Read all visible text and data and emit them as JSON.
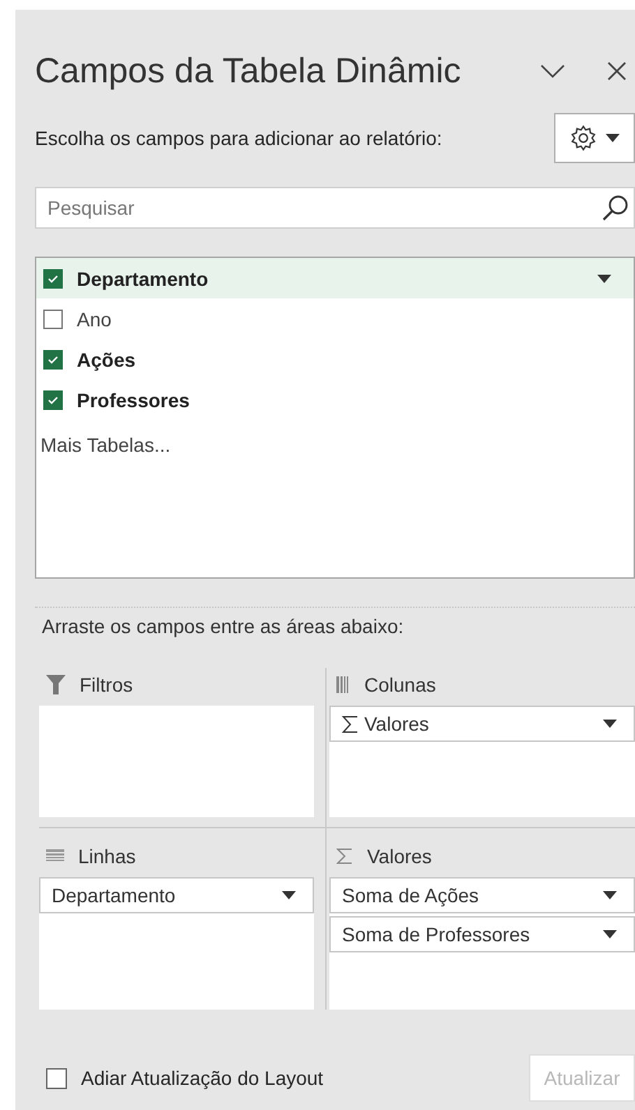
{
  "header": {
    "title": "Campos da Tabela Dinâmic",
    "subtitle": "Escolha os campos para adicionar ao relatório:"
  },
  "search": {
    "placeholder": "Pesquisar"
  },
  "fields": [
    {
      "label": "Departamento",
      "checked": true,
      "selected": true
    },
    {
      "label": "Ano",
      "checked": false,
      "selected": false
    },
    {
      "label": "Ações",
      "checked": true,
      "selected": false
    },
    {
      "label": "Professores",
      "checked": true,
      "selected": false
    }
  ],
  "more_tables": "Mais Tabelas...",
  "drag_hint": "Arraste os campos entre as áreas abaixo:",
  "areas": [
    {
      "kind": "filter",
      "title": "Filtros"
    },
    {
      "kind": "columns",
      "title": "Colunas",
      "items": [
        {
          "label": "Valores",
          "sigma": true
        }
      ]
    },
    {
      "kind": "rows",
      "title": "Linhas",
      "items": [
        {
          "label": "Departamento",
          "sigma": false
        }
      ]
    },
    {
      "kind": "values",
      "title": "Valores",
      "items": [
        {
          "label": "Soma de Ações",
          "sigma": false
        },
        {
          "label": "Soma de Professores",
          "sigma": false
        }
      ]
    }
  ],
  "defer": {
    "label": "Adiar Atualização do Layout",
    "checked": false
  },
  "update_button": {
    "label": "Atualizar",
    "disabled": true
  }
}
